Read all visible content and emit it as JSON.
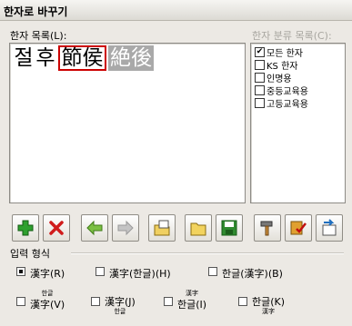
{
  "window": {
    "title": "한자로 바꾸기"
  },
  "hanja_list": {
    "label": "한자 목록(L):",
    "glyphs": [
      "절",
      "후",
      "節",
      "侯",
      "絶",
      "後"
    ]
  },
  "categories": {
    "label": "한자 분류 목록(C):",
    "items": [
      {
        "label": "모든 한자",
        "checked": true
      },
      {
        "label": "KS 한자",
        "checked": false
      },
      {
        "label": "인명용",
        "checked": false
      },
      {
        "label": "중등교육용",
        "checked": false
      },
      {
        "label": "고등교육용",
        "checked": false
      }
    ]
  },
  "toolbar": {
    "buttons": [
      "add",
      "delete",
      "prev",
      "next",
      "open-dictionary",
      "open-folder",
      "save",
      "tools",
      "dictionary-edit",
      "register"
    ]
  },
  "input_format": {
    "label": "입력 형식",
    "options": {
      "hanja": "漢字(R)",
      "hanja_hangul": "漢字(한글)(H)",
      "hangul_hanja": "한글(漢字)(B)",
      "ruby_v_top": "한글",
      "ruby_v_bottom": "漢字(V)",
      "ruby_j_top": "漢字(J)",
      "ruby_j_bottom": "한글",
      "ruby_i_top": "漢字",
      "ruby_i_bottom": "한글(I)",
      "ruby_k_top": "한글(K)",
      "ruby_k_bottom": "漢字"
    }
  }
}
